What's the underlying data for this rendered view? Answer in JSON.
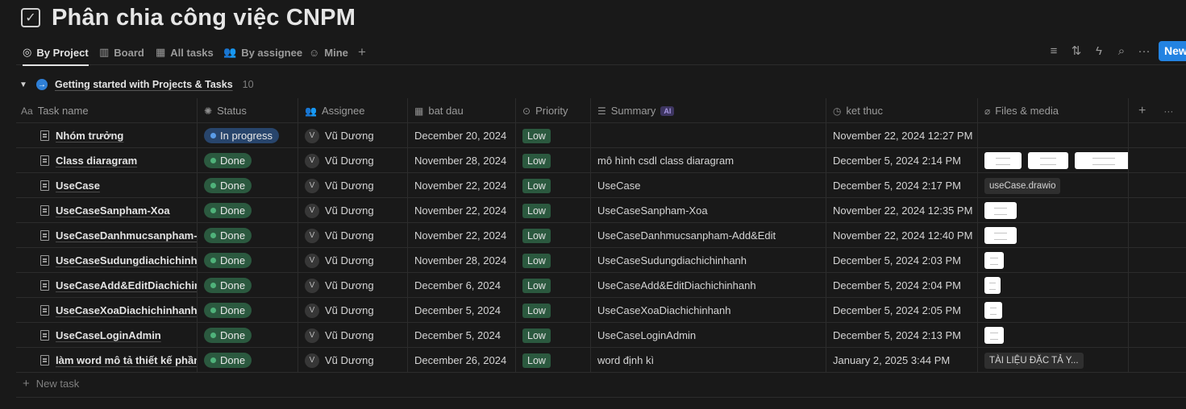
{
  "page": {
    "title": "Phân chia công việc CNPM",
    "title_icon": "checkbox-icon"
  },
  "views": {
    "tabs": [
      {
        "label": "By Project",
        "icon": "target-icon",
        "active": true
      },
      {
        "label": "Board",
        "icon": "board-icon",
        "active": false
      },
      {
        "label": "All tasks",
        "icon": "table-icon",
        "active": false
      },
      {
        "label": "By assignee",
        "icon": "people-icon",
        "active": false
      },
      {
        "label": "Mine",
        "icon": "person-icon",
        "active": false
      }
    ],
    "add_view": "+"
  },
  "toolbar": {
    "icons": [
      "filter-icon",
      "sort-icon",
      "automation-icon",
      "search-icon",
      "more-icon"
    ],
    "new_label": "New",
    "accent": "#2383e2"
  },
  "group": {
    "name": "Getting started with Projects & Tasks",
    "count": "10"
  },
  "columns": {
    "name": "Task name",
    "name_icon_text": "Aa",
    "status": "Status",
    "assignee": "Assignee",
    "start": "bat dau",
    "priority": "Priority",
    "summary": "Summary",
    "summary_badge": "AI",
    "end": "ket thuc",
    "files": "Files & media"
  },
  "rows": [
    {
      "name": "Nhóm trưởng",
      "status": "In progress",
      "status_type": "inprogress",
      "avatar": "V",
      "assignee": "Vũ Dương",
      "start": "December 20, 2024",
      "priority": "Low",
      "summary": "",
      "end": "November 22, 2024 12:27 PM",
      "files": []
    },
    {
      "name": "Class diaragram",
      "status": "Done",
      "status_type": "done",
      "avatar": "V",
      "assignee": "Vũ Dương",
      "start": "November 28, 2024",
      "priority": "Low",
      "summary": "mô hình csdl class diaragram",
      "end": "December 5, 2024 2:14 PM",
      "files": [
        {
          "kind": "thumb",
          "w": 46
        },
        {
          "kind": "thumb",
          "w": 50
        },
        {
          "kind": "thumb",
          "w": 72
        }
      ]
    },
    {
      "name": "UseCase",
      "status": "Done",
      "status_type": "done",
      "avatar": "V",
      "assignee": "Vũ Dương",
      "start": "November 22, 2024",
      "priority": "Low",
      "summary": "UseCase",
      "end": "December 5, 2024 2:17 PM",
      "files": [
        {
          "kind": "chip",
          "label": "useCase.drawio"
        }
      ]
    },
    {
      "name": "UseCaseSanpham-Xoa",
      "status": "Done",
      "status_type": "done",
      "avatar": "V",
      "assignee": "Vũ Dương",
      "start": "November 22, 2024",
      "priority": "Low",
      "summary": "UseCaseSanpham-Xoa",
      "end": "November 22, 2024 12:35 PM",
      "files": [
        {
          "kind": "thumb",
          "w": 40
        }
      ]
    },
    {
      "name": "UseCaseDanhmucsanpham-Add&Edit",
      "status": "Done",
      "status_type": "done",
      "avatar": "V",
      "assignee": "Vũ Dương",
      "start": "November 22, 2024",
      "priority": "Low",
      "summary": "UseCaseDanhmucsanpham-Add&Edit",
      "end": "November 22, 2024 12:40 PM",
      "files": [
        {
          "kind": "thumb",
          "w": 40
        }
      ]
    },
    {
      "name": "UseCaseSudungdiachichinhanh",
      "status": "Done",
      "status_type": "done",
      "avatar": "V",
      "assignee": "Vũ Dương",
      "start": "November 28, 2024",
      "priority": "Low",
      "summary": "UseCaseSudungdiachichinhanh",
      "end": "December 5, 2024 2:03 PM",
      "files": [
        {
          "kind": "thumb",
          "w": 24
        }
      ]
    },
    {
      "name": "UseCaseAdd&EditDiachichinhanh",
      "status": "Done",
      "status_type": "done",
      "avatar": "V",
      "assignee": "Vũ Dương",
      "start": "December 6, 2024",
      "priority": "Low",
      "summary": "UseCaseAdd&EditDiachichinhanh",
      "end": "December 5, 2024 2:04 PM",
      "files": [
        {
          "kind": "thumb",
          "w": 20
        }
      ]
    },
    {
      "name": "UseCaseXoaDiachichinhanh",
      "status": "Done",
      "status_type": "done",
      "avatar": "V",
      "assignee": "Vũ Dương",
      "start": "December 5, 2024",
      "priority": "Low",
      "summary": "UseCaseXoaDiachichinhanh",
      "end": "December 5, 2024 2:05 PM",
      "files": [
        {
          "kind": "thumb",
          "w": 22
        }
      ]
    },
    {
      "name": "UseCaseLoginAdmin",
      "status": "Done",
      "status_type": "done",
      "avatar": "V",
      "assignee": "Vũ Dương",
      "start": "December 5, 2024",
      "priority": "Low",
      "summary": "UseCaseLoginAdmin",
      "end": "December 5, 2024 2:13 PM",
      "files": [
        {
          "kind": "thumb",
          "w": 24
        }
      ]
    },
    {
      "name": "làm word mô tả thiết kế phần mềm",
      "status": "Done",
      "status_type": "done",
      "avatar": "V",
      "assignee": "Vũ Dương",
      "start": "December 26, 2024",
      "priority": "Low",
      "summary": "word định kì",
      "end": "January 2, 2025 3:44 PM",
      "files": [
        {
          "kind": "chip",
          "label": "TÀI LIỆU ĐẶC TẢ Y..."
        }
      ]
    }
  ],
  "new_task_label": "New task"
}
